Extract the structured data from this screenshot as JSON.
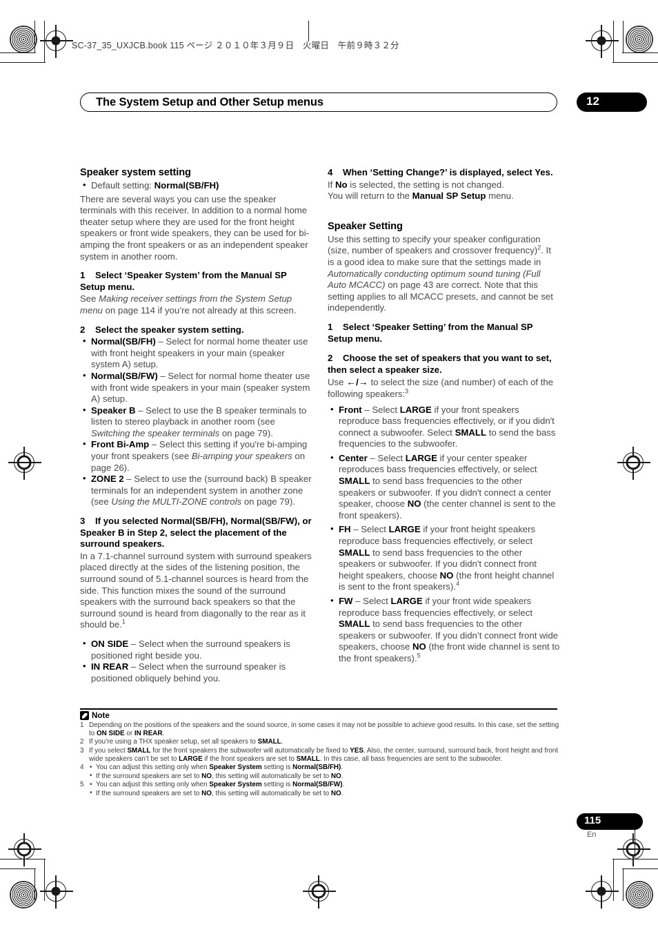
{
  "header": {
    "book_line": "SC-37_35_UXJCB.book   115 ページ   ２０１０年３月９日　火曜日　午前９時３２分",
    "running_title": "The System Setup and Other Setup menus",
    "chapter_number": "12"
  },
  "left_column": {
    "section_title": "Speaker system setting",
    "default_setting_prefix": "Default setting: ",
    "default_setting_value": "Normal(SB/FH)",
    "intro": "There are several ways you can use the speaker terminals with this receiver. In addition to a normal home theater setup where they are used for the front height speakers or front wide speakers, they can be used for bi-amping the front speakers or as an independent speaker system in another room.",
    "step1_num": "1",
    "step1_text": "Select ‘Speaker System’ from the Manual SP Setup menu.",
    "step1_body_a": "See ",
    "step1_body_italic": "Making receiver settings from the System Setup menu",
    "step1_body_b": " on page 114 if you’re not already at this screen.",
    "step2_num": "2",
    "step2_text": "Select the speaker system setting.",
    "bullets": [
      {
        "term": "Normal(SB/FH)",
        "text": " – Select for normal home theater use with front height speakers in your main (speaker system A) setup."
      },
      {
        "term": "Normal(SB/FW)",
        "text": " – Select for normal home theater use with front wide speakers in your main (speaker system A) setup."
      },
      {
        "term": "Speaker B",
        "text_a": " – Select to use the B speaker terminals to listen to stereo playback in another room (see ",
        "italic": "Switching the speaker terminals",
        "text_b": " on page 79)."
      },
      {
        "term": "Front Bi-Amp",
        "text_a": " – Select this setting if you're bi-amping your front speakers (see ",
        "italic": "Bi-amping your speakers",
        "text_b": " on page 26)."
      },
      {
        "term": "ZONE 2",
        "text_a": " – Select to use the (surround back) B speaker terminals for an independent system in another zone (see ",
        "italic": "Using the MULTI-ZONE controls",
        "text_b": " on page 79)."
      }
    ],
    "step3_num": "3",
    "step3_text": "If you selected Normal(SB/FH), Normal(SB/FW), or Speaker B in Step 2, select the placement of the surround speakers.",
    "step3_body": "In a 7.1-channel surround system with surround speakers placed directly at the sides of the listening position, the surround sound of 5.1-channel sources is heard from the side. This function mixes the sound of the surround speakers with the surround back speakers so that the surround sound is heard from diagonally to the rear as it should be.",
    "step3_body_sup": "1",
    "bullets2": [
      {
        "term": "ON SIDE",
        "text": " – Select when the surround speakers is positioned right beside you."
      },
      {
        "term": "IN REAR",
        "text": " – Select when the surround speaker is positioned obliquely behind you."
      }
    ]
  },
  "right_column": {
    "step4_num": "4",
    "step4_text": "When ‘Setting Change?’ is displayed, select Yes.",
    "step4_body_a": "If ",
    "step4_body_bold": "No",
    "step4_body_b": " is selected, the setting is not changed.",
    "step4_body2_a": "You will return to the ",
    "step4_body2_bold": "Manual SP Setup",
    "step4_body2_b": " menu.",
    "section_title": "Speaker Setting",
    "intro_a": "Use this setting to specify your speaker configuration (size, number of speakers and crossover frequency)",
    "intro_sup": "2",
    "intro_b": ". It is a good idea to make sure that the settings made in ",
    "intro_italic": "Automatically conducting optimum sound tuning (Full Auto MCACC)",
    "intro_c": " on page 43 are correct. Note that this setting applies to all MCACC presets, and cannot be set independently.",
    "step1_num": "1",
    "step1_text": "Select ‘Speaker Setting’ from the Manual SP Setup menu.",
    "step2_num": "2",
    "step2_text": "Choose the set of speakers that you want to set, then select a speaker size.",
    "step2_body_a": "Use ",
    "step2_arrow_left": "←",
    "step2_arrow_sep": "/",
    "step2_arrow_right": "→",
    "step2_body_b": " to select the size (and number) of each of the following speakers:",
    "step2_body_sup": "3",
    "bullets": [
      {
        "term": "Front",
        "seg1": " – Select ",
        "b1": "LARGE",
        "seg2": " if your front speakers reproduce bass frequencies effectively, or if you didn't connect a subwoofer. Select ",
        "b2": "SMALL",
        "seg3": " to send the bass frequencies to the subwoofer.",
        "b3": "",
        "seg4": "",
        "sup": ""
      },
      {
        "term": "Center",
        "seg1": " – Select ",
        "b1": "LARGE",
        "seg2": " if your center speaker reproduces bass frequencies effectively, or select ",
        "b2": "SMALL",
        "seg3": " to send bass frequencies to the other speakers or subwoofer. If you didn't connect a center speaker, choose ",
        "b3": "NO",
        "seg4": " (the center channel is sent to the front speakers).",
        "sup": ""
      },
      {
        "term": "FH",
        "seg1": " – Select ",
        "b1": "LARGE",
        "seg2": " if your front height speakers reproduce bass frequencies effectively, or select ",
        "b2": "SMALL",
        "seg3": " to send bass frequencies to the other speakers or subwoofer. If you didn't connect front height speakers, choose ",
        "b3": "NO",
        "seg4": " (the front height channel is sent to the front speakers).",
        "sup": "4"
      },
      {
        "term": "FW",
        "seg1": " – Select ",
        "b1": "LARGE",
        "seg2": " if your front wide speakers reproduce bass frequencies effectively, or select ",
        "b2": "SMALL",
        "seg3": " to send bass frequencies to the other speakers or subwoofer. If you didn’t connect front wide speakers, choose ",
        "b3": "NO",
        "seg4": " (the front wide channel is sent to the front speakers).",
        "sup": "5"
      }
    ]
  },
  "notes": {
    "label": "Note",
    "items": [
      {
        "num": "1",
        "a": "Depending on the positions of the speakers and the sound source, in some cases it may not be possible to achieve good results. In this case, set the setting to ",
        "b1": "ON SIDE",
        "mid": " or ",
        "b2": "IN REAR",
        "end": "."
      },
      {
        "num": "2",
        "a": "If you’re using a THX speaker setup, set all speakers to ",
        "b1": "SMALL",
        "mid": "",
        "b2": "",
        "end": "."
      },
      {
        "num": "3",
        "a": "If you select ",
        "b1": "SMALL",
        "a2": " for the front speakers the subwoofer will automatically be fixed to ",
        "b2": "YES",
        "a3": ". Also, the center, surround, surround back, front height and front wide speakers can’t be set to ",
        "b3": "LARGE",
        "a4": " if the front speakers are set to ",
        "b4": "SMALL",
        "a5": ". In this case, all bass frequencies are sent to the subwoofer."
      },
      {
        "num": "4",
        "sub1_a": "You can adjust this setting only when ",
        "sub1_b1": "Speaker System",
        "sub1_mid": " setting is ",
        "sub1_b2": "Normal(SB/FH)",
        "sub1_end": ".",
        "sub2_a": "If the surround speakers are set to ",
        "sub2_b1": "NO",
        "sub2_mid": ", this setting will automatically be set to ",
        "sub2_b2": "NO",
        "sub2_end": "."
      },
      {
        "num": "5",
        "sub1_a": "You can adjust this setting only when ",
        "sub1_b1": "Speaker System",
        "sub1_mid": " setting is ",
        "sub1_b2": "Normal(SB/FW)",
        "sub1_end": ".",
        "sub2_a": "If the surround speakers are set to ",
        "sub2_b1": "NO",
        "sub2_mid": ", this setting will automatically be set to ",
        "sub2_b2": "NO",
        "sub2_end": "."
      }
    ]
  },
  "footer": {
    "page_number": "115",
    "language": "En"
  }
}
